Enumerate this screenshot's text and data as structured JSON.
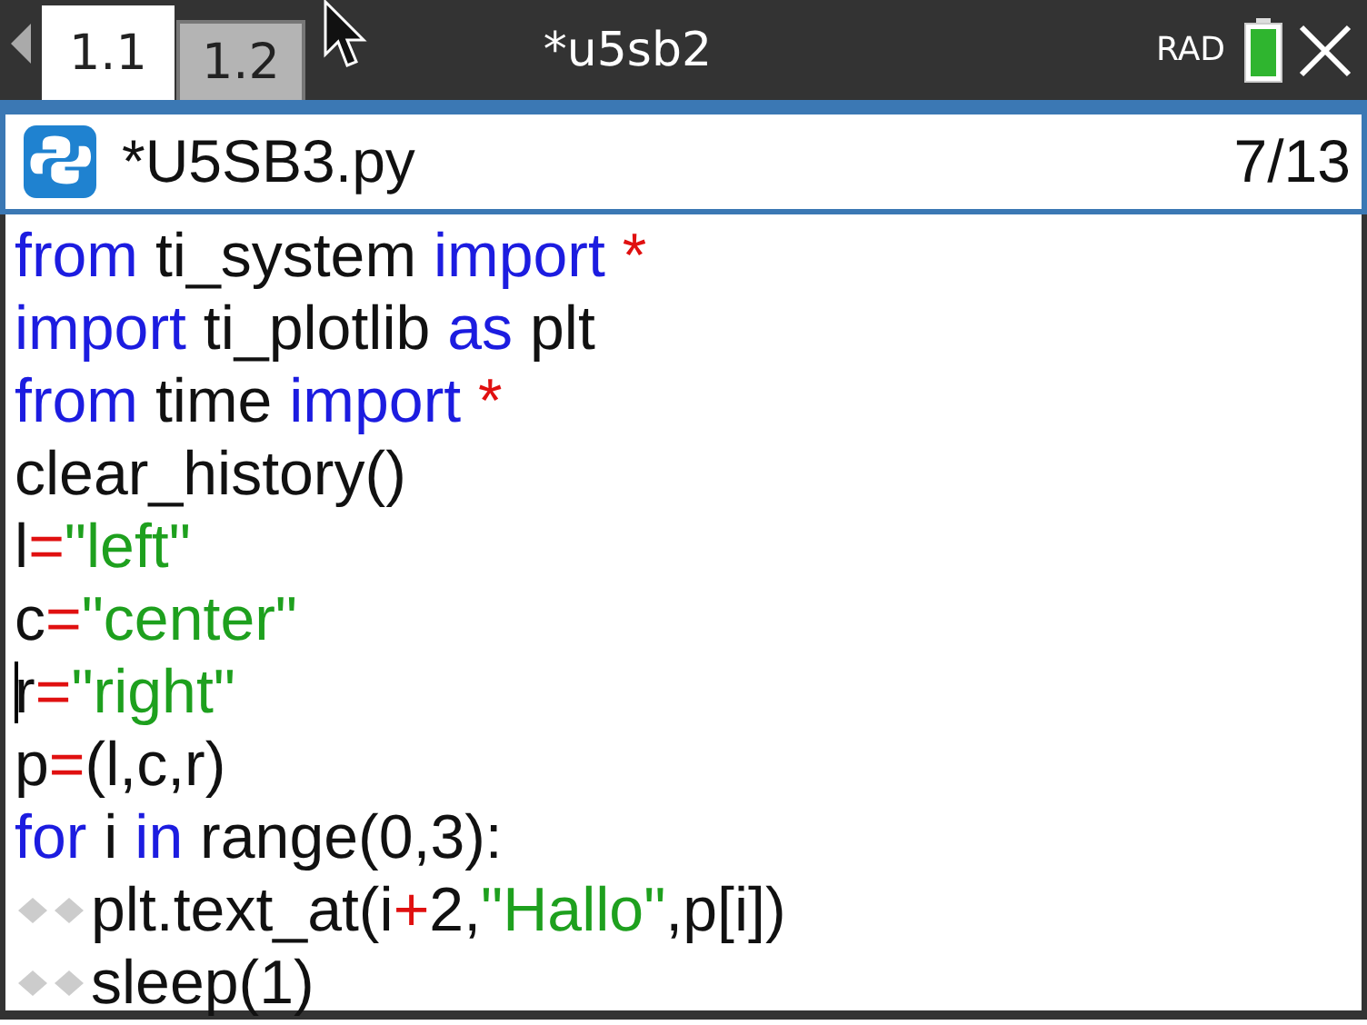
{
  "top_bar": {
    "tabs": [
      {
        "label": "1.1",
        "selected": true
      },
      {
        "label": "1.2",
        "selected": false
      }
    ],
    "title": "*u5sb2",
    "mode": "RAD"
  },
  "editor": {
    "file_name": "*U5SB3.py",
    "position": "7/13",
    "lines": [
      {
        "cursor": false,
        "tokens": [
          {
            "kind": "keyword",
            "text": "from"
          },
          {
            "kind": "plain",
            "text": " ti_system "
          },
          {
            "kind": "keyword",
            "text": "import"
          },
          {
            "kind": "operator",
            "text": " *"
          }
        ]
      },
      {
        "cursor": false,
        "tokens": [
          {
            "kind": "keyword",
            "text": "import"
          },
          {
            "kind": "plain",
            "text": " ti_plotlib "
          },
          {
            "kind": "keyword",
            "text": "as"
          },
          {
            "kind": "plain",
            "text": " plt"
          }
        ]
      },
      {
        "cursor": false,
        "tokens": [
          {
            "kind": "keyword",
            "text": "from"
          },
          {
            "kind": "plain",
            "text": " time "
          },
          {
            "kind": "keyword",
            "text": "import"
          },
          {
            "kind": "operator",
            "text": " *"
          }
        ]
      },
      {
        "cursor": false,
        "tokens": [
          {
            "kind": "plain",
            "text": "clear_history()"
          }
        ]
      },
      {
        "cursor": false,
        "tokens": [
          {
            "kind": "plain",
            "text": "l"
          },
          {
            "kind": "operator",
            "text": "="
          },
          {
            "kind": "string",
            "text": "\"left\""
          }
        ]
      },
      {
        "cursor": false,
        "tokens": [
          {
            "kind": "plain",
            "text": "c"
          },
          {
            "kind": "operator",
            "text": "="
          },
          {
            "kind": "string",
            "text": "\"center\""
          }
        ]
      },
      {
        "cursor": true,
        "tokens": [
          {
            "kind": "plain",
            "text": "r"
          },
          {
            "kind": "operator",
            "text": "="
          },
          {
            "kind": "string",
            "text": "\"right\""
          }
        ]
      },
      {
        "cursor": false,
        "tokens": [
          {
            "kind": "plain",
            "text": "p"
          },
          {
            "kind": "operator",
            "text": "="
          },
          {
            "kind": "plain",
            "text": "(l,c,r)"
          }
        ]
      },
      {
        "cursor": false,
        "tokens": [
          {
            "kind": "keyword",
            "text": "for"
          },
          {
            "kind": "plain",
            "text": " i "
          },
          {
            "kind": "keyword",
            "text": "in"
          },
          {
            "kind": "plain",
            "text": " range(0,3):"
          }
        ],
        "children": [
          {
            "cursor": false,
            "tokens": [
              {
                "kind": "plain",
                "text": "plt.text_at(i"
              },
              {
                "kind": "operator",
                "text": "+"
              },
              {
                "kind": "plain",
                "text": "2,"
              },
              {
                "kind": "string",
                "text": "\"Hallo\""
              },
              {
                "kind": "plain",
                "text": ",p[i])"
              }
            ]
          },
          {
            "cursor": false,
            "tokens": [
              {
                "kind": "plain",
                "text": "sleep(1)"
              }
            ]
          }
        ]
      }
    ]
  }
}
